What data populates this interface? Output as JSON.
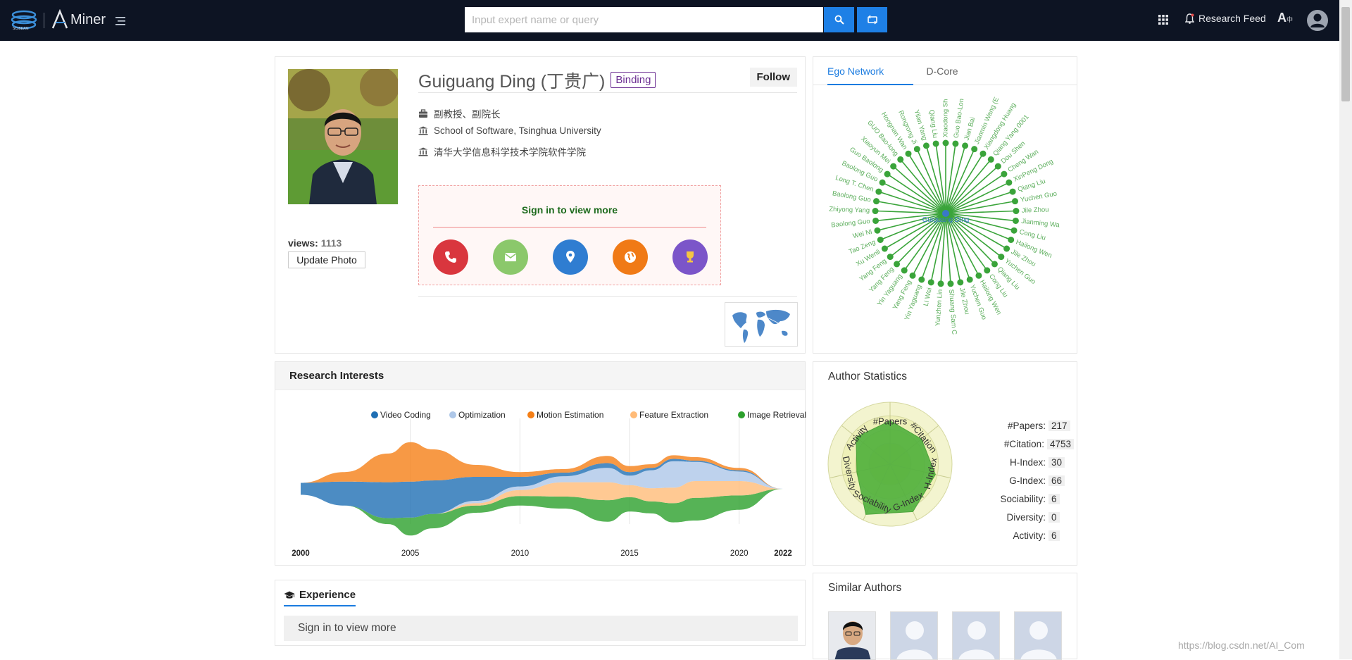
{
  "header": {
    "search_placeholder": "Input expert name or query",
    "research_feed_label": "Research Feed",
    "translate_label": "A",
    "logo_text": "Miner",
    "logo_letter": "A"
  },
  "profile": {
    "name": "Guiguang Ding (丁贵广)",
    "binding_label": "Binding",
    "follow_label": "Follow",
    "position": "副教授、副院长",
    "affiliation_en": "School of Software, Tsinghua University",
    "affiliation_zh": "清华大学信息科学技术学院软件学院",
    "views_label": "views:",
    "views_count": "1113",
    "update_photo_label": "Update Photo",
    "signin_more": "Sign in to view more",
    "contacts": [
      {
        "name": "phone-icon",
        "color": "#d9363e"
      },
      {
        "name": "email-icon",
        "color": "#8bc86b"
      },
      {
        "name": "location-icon",
        "color": "#2f7dd1"
      },
      {
        "name": "homepage-icon",
        "color": "#f07a16"
      },
      {
        "name": "award-icon",
        "color": "#7b55c9"
      }
    ]
  },
  "ego_network": {
    "tabs": [
      "Ego Network",
      "D-Core"
    ],
    "center_label": "Guiguang Ding",
    "node_color": "#3aa43a",
    "nodes": [
      "Xiaodong Sh",
      "Guo Bao-Lon",
      "Jian Bai",
      "Jianmin Wang (E",
      "Xiangdong Huang",
      "Qiang Yang 0001",
      "Dou Shen",
      "Cheng Wan",
      "XinPeng Dong",
      "Qiang Liu",
      "Yuchen Guo",
      "Jile Zhou",
      "Jianming Wa",
      "Cong Liu",
      "Hailong Wen",
      "Jile Zhou",
      "Yuchen Guo",
      "Qiang Liu",
      "Cong Liu",
      "Hailong Wen",
      "Yuchen Guo",
      "Jile Zhou",
      "Shuang Sam C",
      "Yunzhen Lin",
      "Li Wei",
      "Yin Yaguang",
      "Yang Feng",
      "Yin Yaguang",
      "Yang Feng",
      "Yang Feng",
      "Xu Wenli",
      "Tao Zeng",
      "Wei Ni",
      "Baolong Guo",
      "Zhiyong Yang",
      "Baolong Guo",
      "Long T. Chen",
      "Baolong Guo",
      "Guo Baolong",
      "Xiaoyun Mei",
      "GUO Bao-long",
      "Hongnan Wan",
      "Rongrong Ji",
      "Yilan Yang",
      "Qiang Liu"
    ]
  },
  "research_interests": {
    "title": "Research Interests",
    "legend": [
      {
        "label": "Video Coding",
        "color": "#1f6fb4"
      },
      {
        "label": "Optimization",
        "color": "#aec7e8"
      },
      {
        "label": "Motion Estimation",
        "color": "#f57f16"
      },
      {
        "label": "Feature Extraction",
        "color": "#ffbb78"
      },
      {
        "label": "Image Retrieval",
        "color": "#2ca02c"
      }
    ],
    "axis_ticks": [
      "2000",
      "2005",
      "2010",
      "2015",
      "2020",
      "2022"
    ]
  },
  "chart_data": {
    "type": "area",
    "title": "Research Interests",
    "x": [
      2000,
      2002,
      2004,
      2005,
      2006,
      2008,
      2010,
      2012,
      2014,
      2015,
      2016,
      2017,
      2018,
      2020,
      2022
    ],
    "series": [
      {
        "name": "Video Coding",
        "values": [
          1,
          2,
          3,
          3,
          2.8,
          2,
          0.8,
          0.3,
          0.4,
          0.3,
          0.2,
          0.2,
          0.1,
          0.1,
          0
        ]
      },
      {
        "name": "Optimization",
        "values": [
          0,
          0,
          0,
          0,
          0,
          0.2,
          0.3,
          0.5,
          1.2,
          0.8,
          1.5,
          2.2,
          1.6,
          0.8,
          0
        ]
      },
      {
        "name": "Motion Estimation",
        "values": [
          0,
          0.8,
          2.4,
          3.3,
          2.6,
          1,
          0.4,
          0.3,
          0.6,
          0.5,
          0.3,
          0.3,
          0.3,
          0.2,
          0
        ]
      },
      {
        "name": "Feature Extraction",
        "values": [
          0,
          0,
          0,
          0,
          0,
          0.2,
          0.5,
          1.2,
          1.5,
          1,
          1.1,
          1.3,
          1.4,
          1.2,
          0
        ]
      },
      {
        "name": "Image Retrieval",
        "values": [
          0,
          0,
          0.5,
          1.5,
          1.2,
          0.6,
          0.8,
          1,
          1.8,
          1.2,
          1,
          1.6,
          1.9,
          1.2,
          0
        ]
      }
    ],
    "xlabel": "",
    "ylabel": "",
    "legend_position": "top"
  },
  "author_statistics": {
    "title": "Author Statistics",
    "radar_axes": [
      "#Papers",
      "#Citation",
      "H-Index",
      "G-Index",
      "Sociability",
      "Diversity",
      "Activity"
    ],
    "radar_values": [
      0.7,
      0.65,
      0.75,
      0.85,
      0.9,
      0.55,
      0.7
    ],
    "stats": [
      {
        "label": "#Papers:",
        "value": "217"
      },
      {
        "label": "#Citation:",
        "value": "4753"
      },
      {
        "label": "H-Index:",
        "value": "30"
      },
      {
        "label": "G-Index:",
        "value": "66"
      },
      {
        "label": "Sociability:",
        "value": "6"
      },
      {
        "label": "Diversity:",
        "value": "0"
      },
      {
        "label": "Activity:",
        "value": "6"
      }
    ]
  },
  "experience": {
    "title": "Experience",
    "signin_more": "Sign in to view more"
  },
  "similar_authors": {
    "title": "Similar Authors"
  },
  "watermark": "https://blog.csdn.net/AI_Com"
}
